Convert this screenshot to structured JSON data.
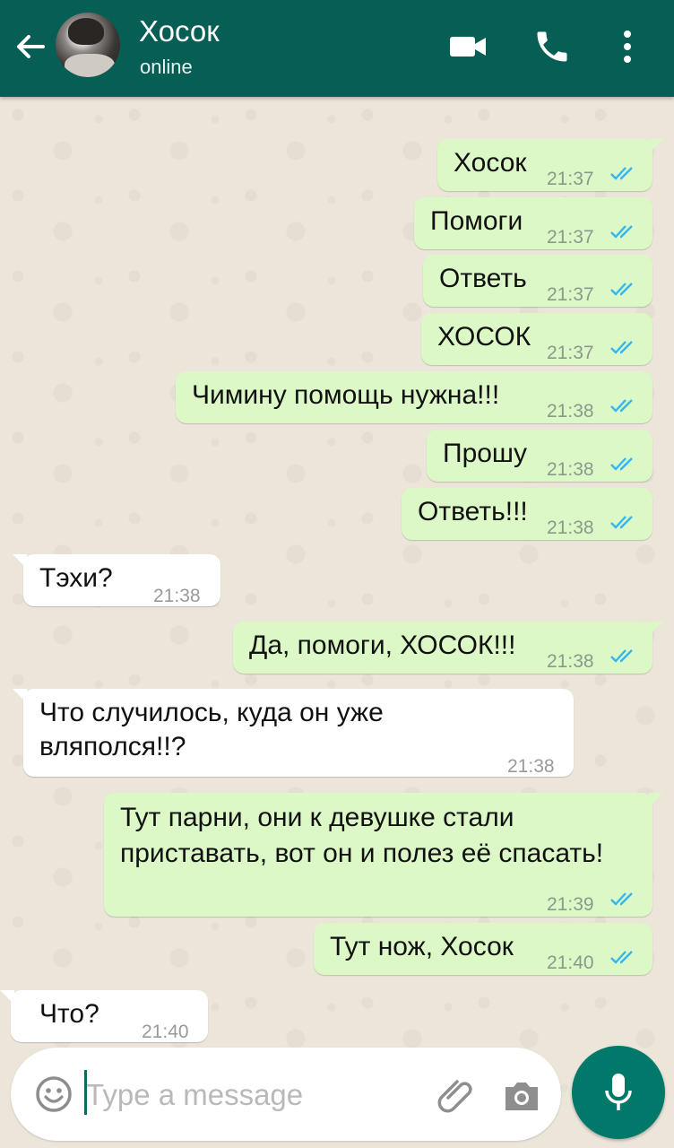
{
  "header": {
    "contact_name": "Хосок",
    "status": "online",
    "colors": {
      "bar": "#075e54",
      "accent": "#00796b"
    },
    "icons": [
      "back-arrow-icon",
      "video-call-icon",
      "phone-icon",
      "more-vert-icon"
    ]
  },
  "messages": [
    {
      "dir": "out",
      "text": "Хосок",
      "time": "21:37"
    },
    {
      "dir": "out",
      "text": "Помоги",
      "time": "21:37"
    },
    {
      "dir": "out",
      "text": "Ответь",
      "time": "21:37"
    },
    {
      "dir": "out",
      "text": "ХОСОК",
      "time": "21:37"
    },
    {
      "dir": "out",
      "text": "Чимину помощь нужна!!!",
      "time": "21:38"
    },
    {
      "dir": "out",
      "text": "Прошу",
      "time": "21:38"
    },
    {
      "dir": "out",
      "text": "Ответь!!!",
      "time": "21:38"
    },
    {
      "dir": "in",
      "text": "Тэхи?",
      "time": "21:38"
    },
    {
      "dir": "out",
      "text": "Да, помоги, ХОСОК!!!",
      "time": "21:38"
    },
    {
      "dir": "in",
      "text": "Что случилось, куда он уже вляполся!!?",
      "time": "21:38"
    },
    {
      "dir": "out",
      "text": "Тут парни, они к девушке стали приставать, вот он и полез её спасать!",
      "time": "21:39"
    },
    {
      "dir": "out",
      "text": "Тут нож, Хосок",
      "time": "21:40"
    },
    {
      "dir": "in",
      "text": "Что?",
      "time": "21:40"
    }
  ],
  "composer": {
    "placeholder": "Type a message",
    "icons": [
      "emoji-icon",
      "attach-icon",
      "camera-icon",
      "mic-icon"
    ]
  }
}
